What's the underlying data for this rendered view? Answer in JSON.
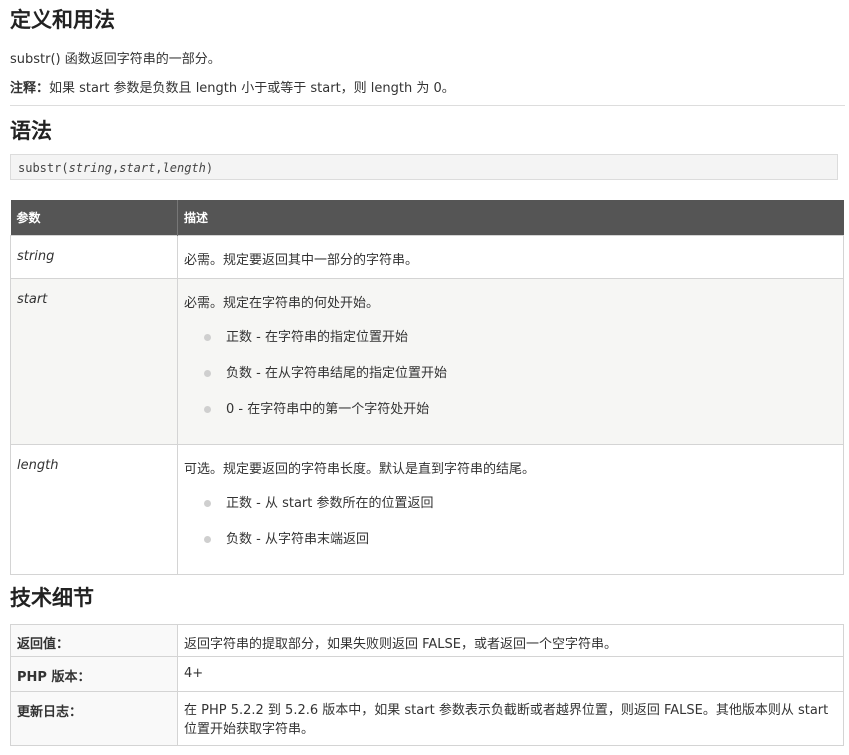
{
  "section_definition": {
    "heading": "定义和用法",
    "intro": "substr() 函数返回字符串的一部分。",
    "note_label": "注释：",
    "note_text": "如果 start 参数是负数且 length 小于或等于 start，则 length 为 0。"
  },
  "section_syntax": {
    "heading": "语法",
    "fn": "substr(",
    "arg1": "string",
    "sep1": ",",
    "arg2": "start",
    "sep2": ",",
    "arg3": "length",
    "close": ")"
  },
  "params_table": {
    "headers": [
      "参数",
      "描述"
    ],
    "rows": [
      {
        "name": "string",
        "desc": "必需。规定要返回其中一部分的字符串。",
        "bullets": []
      },
      {
        "name": "start",
        "desc": "必需。规定在字符串的何处开始。",
        "bullets": [
          "正数 - 在字符串的指定位置开始",
          "负数 - 在从字符串结尾的指定位置开始",
          "0 - 在字符串中的第一个字符处开始"
        ]
      },
      {
        "name": "length",
        "desc": "可选。规定要返回的字符串长度。默认是直到字符串的结尾。",
        "bullets": [
          "正数 - 从 start 参数所在的位置返回",
          "负数 - 从字符串末端返回"
        ]
      }
    ]
  },
  "section_tech": {
    "heading": "技术细节",
    "rows": [
      {
        "key": "返回值：",
        "value": "返回字符串的提取部分，如果失败则返回 FALSE，或者返回一个空字符串。"
      },
      {
        "key": "PHP 版本：",
        "value": "4+"
      },
      {
        "key": "更新日志：",
        "value": "在 PHP 5.2.2 到 5.2.6 版本中，如果 start 参数表示负截断或者越界位置，则返回 FALSE。其他版本则从 start 位置开始获取字符串。"
      }
    ]
  }
}
